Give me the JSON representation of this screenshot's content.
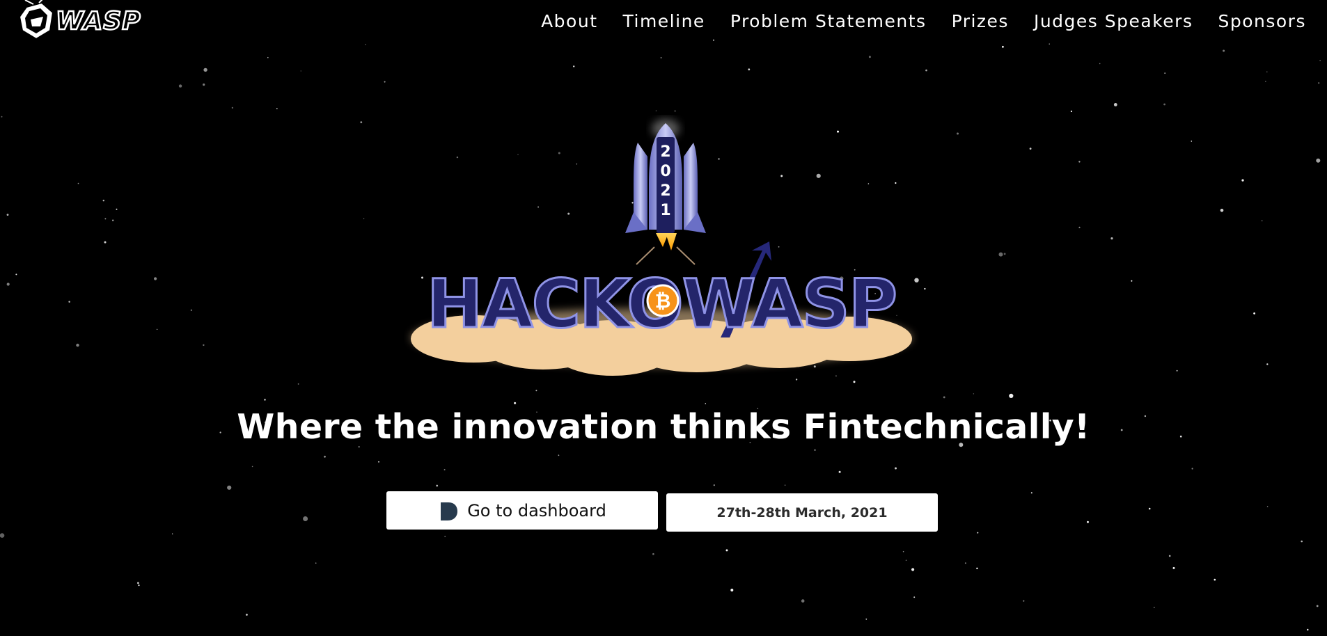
{
  "header": {
    "logo_text": "WASP",
    "nav": [
      {
        "label": "About"
      },
      {
        "label": "Timeline"
      },
      {
        "label": "Problem Statements"
      },
      {
        "label": "Prizes"
      },
      {
        "label": "Judges Speakers"
      },
      {
        "label": "Sponsors"
      }
    ]
  },
  "hero": {
    "rocket_year": "2021",
    "event_logo_text": "HACKOWASP",
    "tagline": "Where the innovation thinks Fintechnically!",
    "dashboard_button": {
      "label": "Go to dashboard",
      "icon": "devfolio-icon"
    },
    "date_button": {
      "label": "27th-28th March, 2021"
    }
  },
  "colors": {
    "background": "#000000",
    "logo_blue": "#24256b",
    "cloud": "#f3cf9d",
    "bitcoin_orange": "#f7931a"
  }
}
